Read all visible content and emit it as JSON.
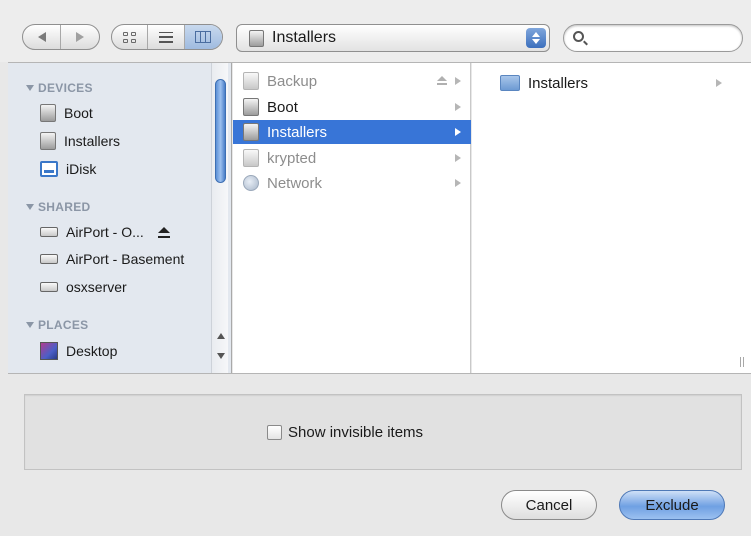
{
  "toolbar": {
    "path_popup_label": "Installers",
    "search_value": ""
  },
  "sidebar": {
    "sections": [
      {
        "heading": "DEVICES",
        "items": [
          {
            "label": "Boot",
            "icon": "disk-icon"
          },
          {
            "label": "Installers",
            "icon": "disk-icon"
          },
          {
            "label": "iDisk",
            "icon": "idisk-icon"
          }
        ]
      },
      {
        "heading": "SHARED",
        "items": [
          {
            "label": "AirPort - O...",
            "icon": "network-computer-icon"
          },
          {
            "label": "AirPort - Basement",
            "icon": "network-computer-icon"
          },
          {
            "label": "osxserver",
            "icon": "network-computer-icon"
          }
        ]
      },
      {
        "heading": "PLACES",
        "items": [
          {
            "label": "Desktop",
            "icon": "desktop-icon"
          }
        ]
      }
    ]
  },
  "columns": [
    {
      "rows": [
        {
          "label": "Backup",
          "icon": "disk-icon",
          "state": "dimmed"
        },
        {
          "label": "Boot",
          "icon": "disk-icon",
          "state": "normal"
        },
        {
          "label": "Installers",
          "icon": "disk-icon",
          "state": "selected"
        },
        {
          "label": "krypted",
          "icon": "disk-icon",
          "state": "dimmed"
        },
        {
          "label": "Network",
          "icon": "globe-icon",
          "state": "dimmed"
        }
      ]
    },
    {
      "rows": [
        {
          "label": "Installers",
          "icon": "folder-icon",
          "state": "normal"
        }
      ]
    }
  ],
  "options": {
    "show_invisible_label": "Show invisible items",
    "show_invisible_checked": false
  },
  "buttons": {
    "cancel": "Cancel",
    "exclude": "Exclude"
  },
  "colors": {
    "selection": "#3875d7",
    "sidebar_bg": "#e3e8ef",
    "sidebar_heading": "#8b96a6"
  }
}
